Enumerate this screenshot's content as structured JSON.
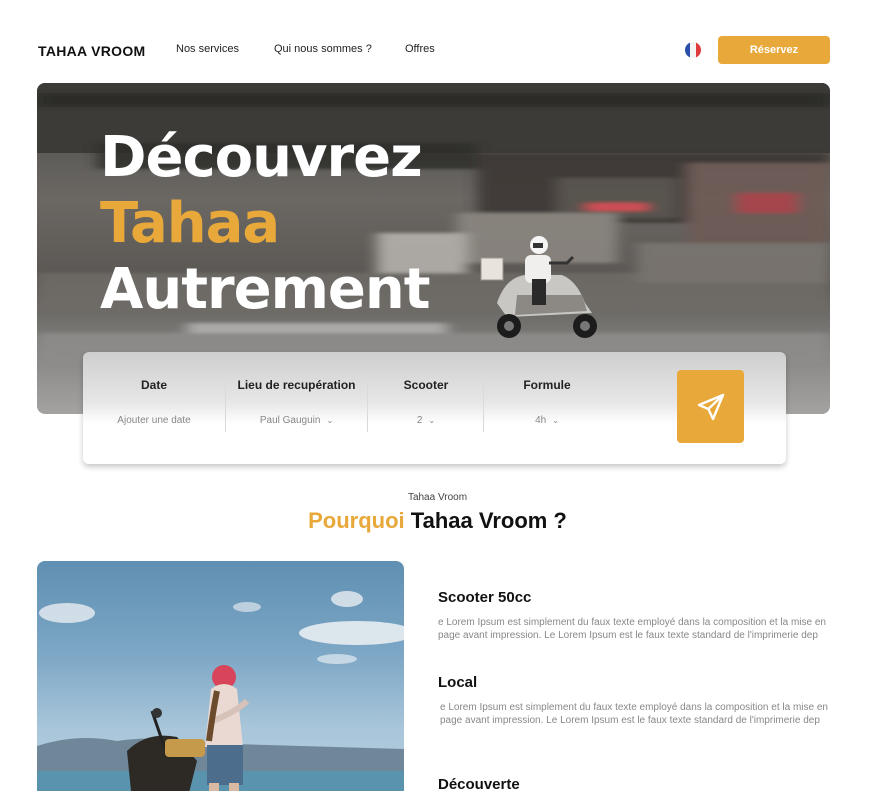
{
  "colors": {
    "accent": "#E8A83A",
    "text": "#111111",
    "muted": "#888888"
  },
  "nav": {
    "brand": "TAHAA VROOM",
    "links": [
      "Nos services",
      "Qui nous sommes ?",
      "Offres"
    ],
    "language_icon": "french-flag-icon",
    "reserve_label": "Réservez"
  },
  "hero": {
    "line1": "Découvrez",
    "line2": "Tahaa",
    "line3": "Autrement"
  },
  "search": {
    "fields": [
      {
        "label": "Date",
        "value": "Ajouter une date"
      },
      {
        "label": "Lieu de recupération",
        "value": "Paul Gauguin"
      },
      {
        "label": "Scooter",
        "value": "2"
      },
      {
        "label": "Formule",
        "value": "4h"
      }
    ],
    "submit_icon": "paper-plane-icon"
  },
  "section": {
    "eyebrow": "Tahaa Vroom",
    "title_accent": "Pourquoi",
    "title_rest": "Tahaa Vroom ?"
  },
  "features": [
    {
      "title": "Scooter 50cc",
      "text": "e Lorem Ipsum est simplement du faux texte employé dans la composition et la mise en page avant impression. Le Lorem Ipsum est le faux texte standard de l'imprimerie dep"
    },
    {
      "title": "Local",
      "text": "e Lorem Ipsum est simplement du faux texte employé dans la composition et la mise en page avant impression. Le Lorem Ipsum est le faux texte standard de l'imprimerie dep"
    },
    {
      "title": "Découverte"
    }
  ]
}
